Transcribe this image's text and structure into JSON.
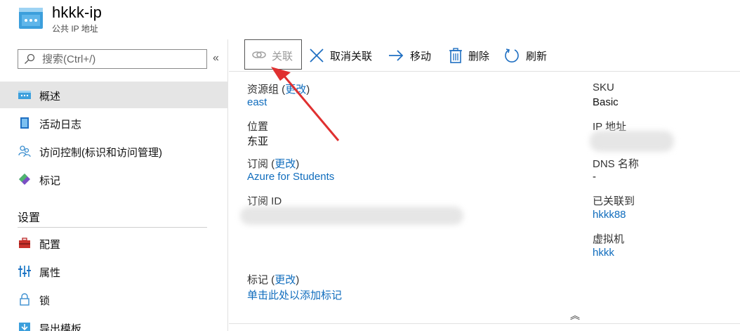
{
  "header": {
    "title": "hkkk-ip",
    "subtitle": "公共 IP 地址",
    "icon": "public-ip-icon"
  },
  "sidebar": {
    "search_placeholder": "搜索(Ctrl+/)",
    "collapse_symbol": "«",
    "items": [
      {
        "label": "概述",
        "icon": "overview-icon"
      },
      {
        "label": "活动日志",
        "icon": "activity-log-icon"
      },
      {
        "label": "访问控制(标识和访问管理)",
        "icon": "iam-icon"
      },
      {
        "label": "标记",
        "icon": "tag-icon"
      }
    ],
    "section_title": "设置",
    "settings_items": [
      {
        "label": "配置",
        "icon": "toolbox-icon"
      },
      {
        "label": "属性",
        "icon": "properties-icon"
      },
      {
        "label": "锁",
        "icon": "lock-icon"
      },
      {
        "label": "导出模板",
        "icon": "export-template-icon"
      }
    ]
  },
  "toolbar": {
    "associate": "关联",
    "dissociate": "取消关联",
    "move": "移动",
    "delete": "删除",
    "refresh": "刷新"
  },
  "essentials": {
    "resource_group_label": "资源组",
    "resource_group_change": "更改",
    "resource_group_value": "east",
    "location_label": "位置",
    "location_value": "东亚",
    "subscription_label": "订阅",
    "subscription_change": "更改",
    "subscription_value": "Azure for Students",
    "subscription_id_label": "订阅 ID",
    "sku_label": "SKU",
    "sku_value": "Basic",
    "ip_label": "IP 地址",
    "dns_label": "DNS 名称",
    "dns_value": "-",
    "associated_label": "已关联到",
    "associated_value": "hkkk88",
    "vm_label": "虚拟机",
    "vm_value": "hkkk",
    "tags_label": "标记",
    "tags_change": "更改",
    "tags_add": "单击此处以添加标记",
    "collapse_symbol": "︽"
  },
  "colors": {
    "link": "#0f6cbd",
    "accent": "#0078d4",
    "annotation_arrow": "#e03030"
  }
}
